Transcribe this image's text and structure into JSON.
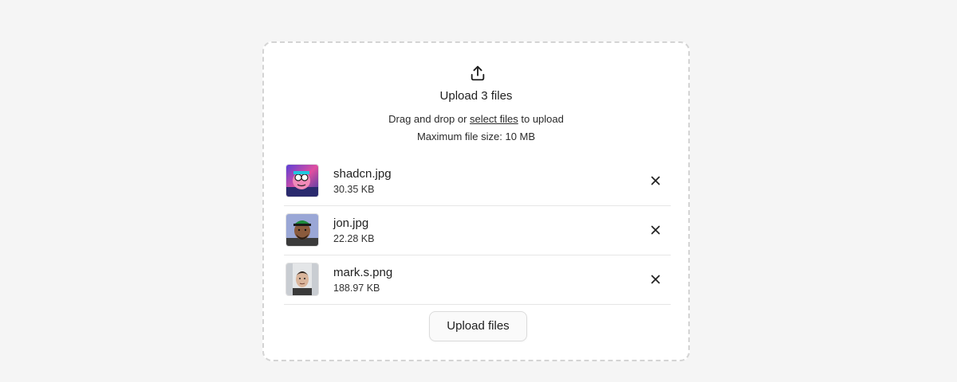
{
  "dropzone": {
    "icon": "upload-icon",
    "title": "Upload 3 files",
    "hint_prefix": "Drag and drop or",
    "hint_link": "select files",
    "hint_suffix": "to upload",
    "max_size": "Maximum file size: 10 MB"
  },
  "files": [
    {
      "name": "shadcn.jpg",
      "size": "30.35 KB",
      "thumb": "avatar-cartoon"
    },
    {
      "name": "jon.jpg",
      "size": "22.28 KB",
      "thumb": "avatar-photo-cap"
    },
    {
      "name": "mark.s.png",
      "size": "188.97 KB",
      "thumb": "avatar-photo-man"
    }
  ],
  "actions": {
    "upload_label": "Upload files",
    "remove_icon": "close-icon"
  }
}
